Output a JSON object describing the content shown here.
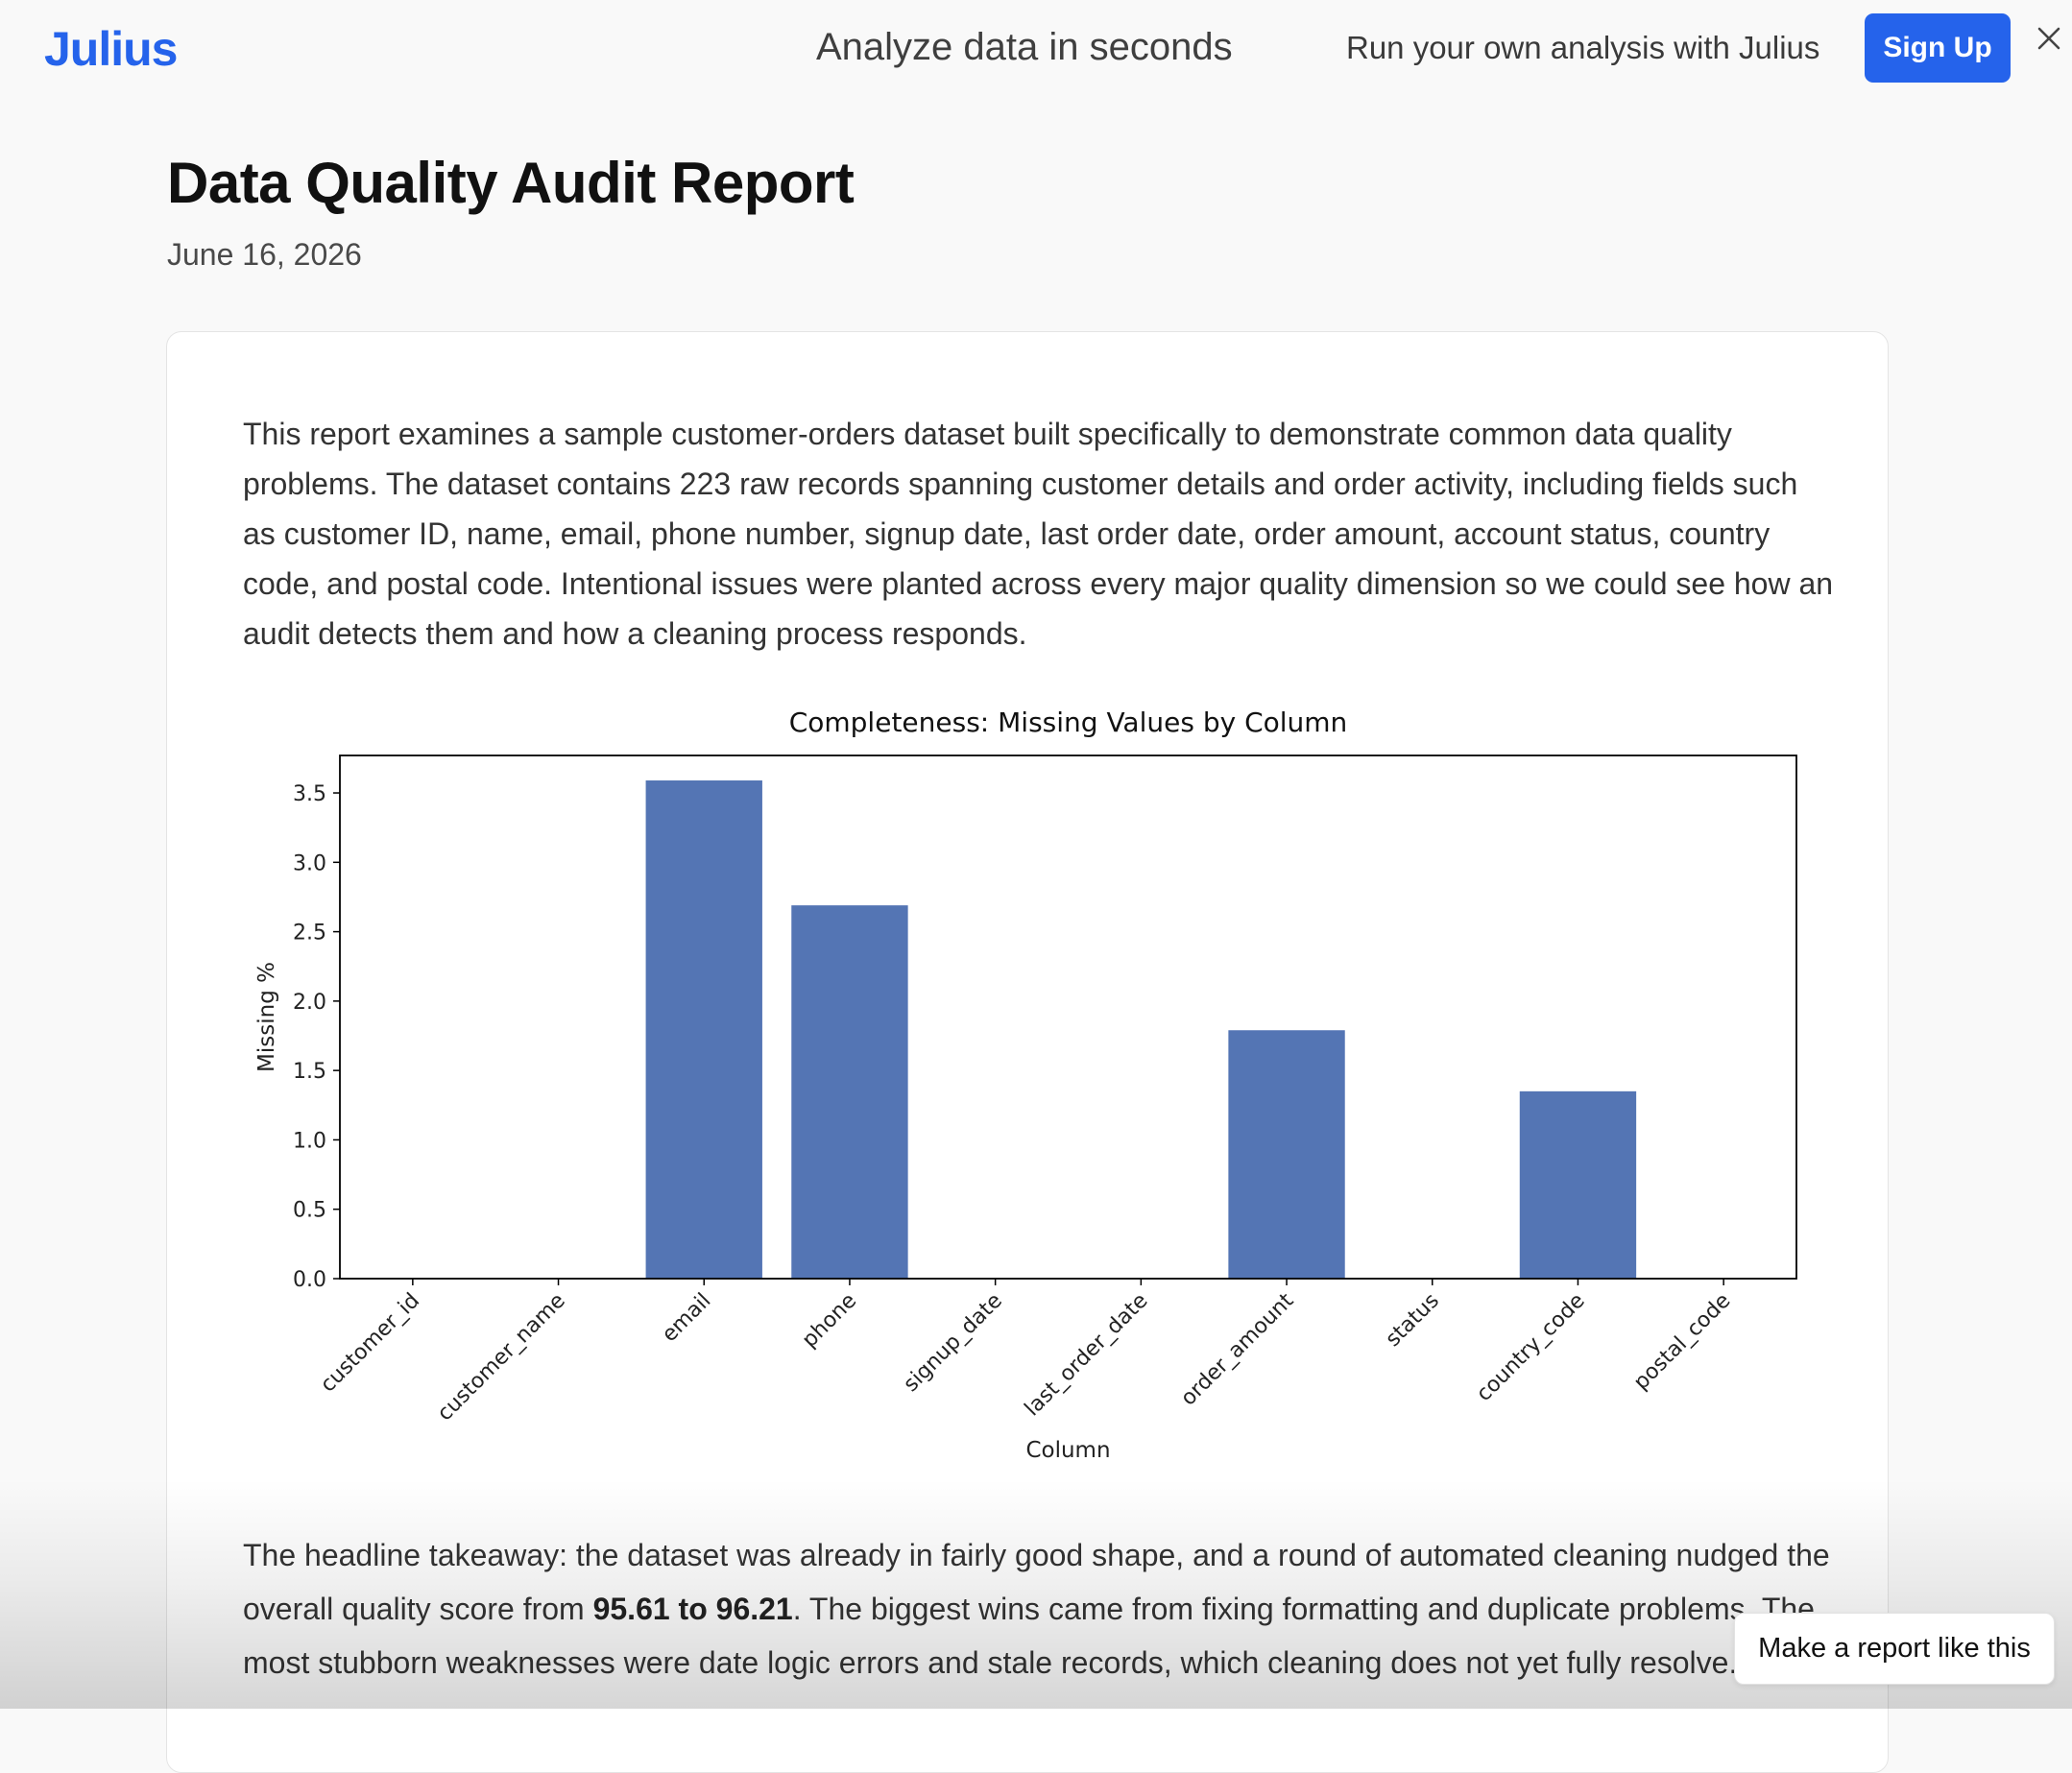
{
  "header": {
    "logo": "Julius",
    "tagline": "Analyze data in seconds",
    "cta_text": "Run your own analysis with Julius",
    "signup_label": "Sign Up",
    "brand_color": "#2563eb"
  },
  "report": {
    "title": "Data Quality Audit Report",
    "date": "June 16, 2026",
    "intro": "This report examines a sample customer-orders dataset built specifically to demonstrate common data quality problems. The dataset contains 223 raw records spanning customer details and order activity, including fields such as customer ID, name, email, phone number, signup date, last order date, order amount, account status, country code, and postal code. Intentional issues were planted across every major quality dimension so we could see how an audit detects them and how a cleaning process responds.",
    "takeaway_before": "The headline takeaway: the dataset was already in fairly good shape, and a round of automated cleaning nudged the overall quality score from ",
    "takeaway_bold": "95.61 to 96.21",
    "takeaway_after": ". The biggest wins came from fixing formatting and duplicate problems. The most stubborn weaknesses were date logic errors and stale records, which cleaning does not yet fully resolve."
  },
  "make_report_label": "Make a report like this",
  "chart_data": {
    "type": "bar",
    "title": "Completeness: Missing Values by Column",
    "xlabel": "Column",
    "ylabel": "Missing %",
    "categories": [
      "customer_id",
      "customer_name",
      "email",
      "phone",
      "signup_date",
      "last_order_date",
      "order_amount",
      "status",
      "country_code",
      "postal_code"
    ],
    "values": [
      0,
      0,
      3.59,
      2.69,
      0,
      0,
      1.79,
      0,
      1.35,
      0
    ],
    "yticks": [
      "0.0",
      "0.5",
      "1.0",
      "1.5",
      "2.0",
      "2.5",
      "3.0",
      "3.5"
    ],
    "ylim": [
      0,
      3.77
    ],
    "bar_color": "#5475b4",
    "grid": false,
    "legend": "none"
  }
}
